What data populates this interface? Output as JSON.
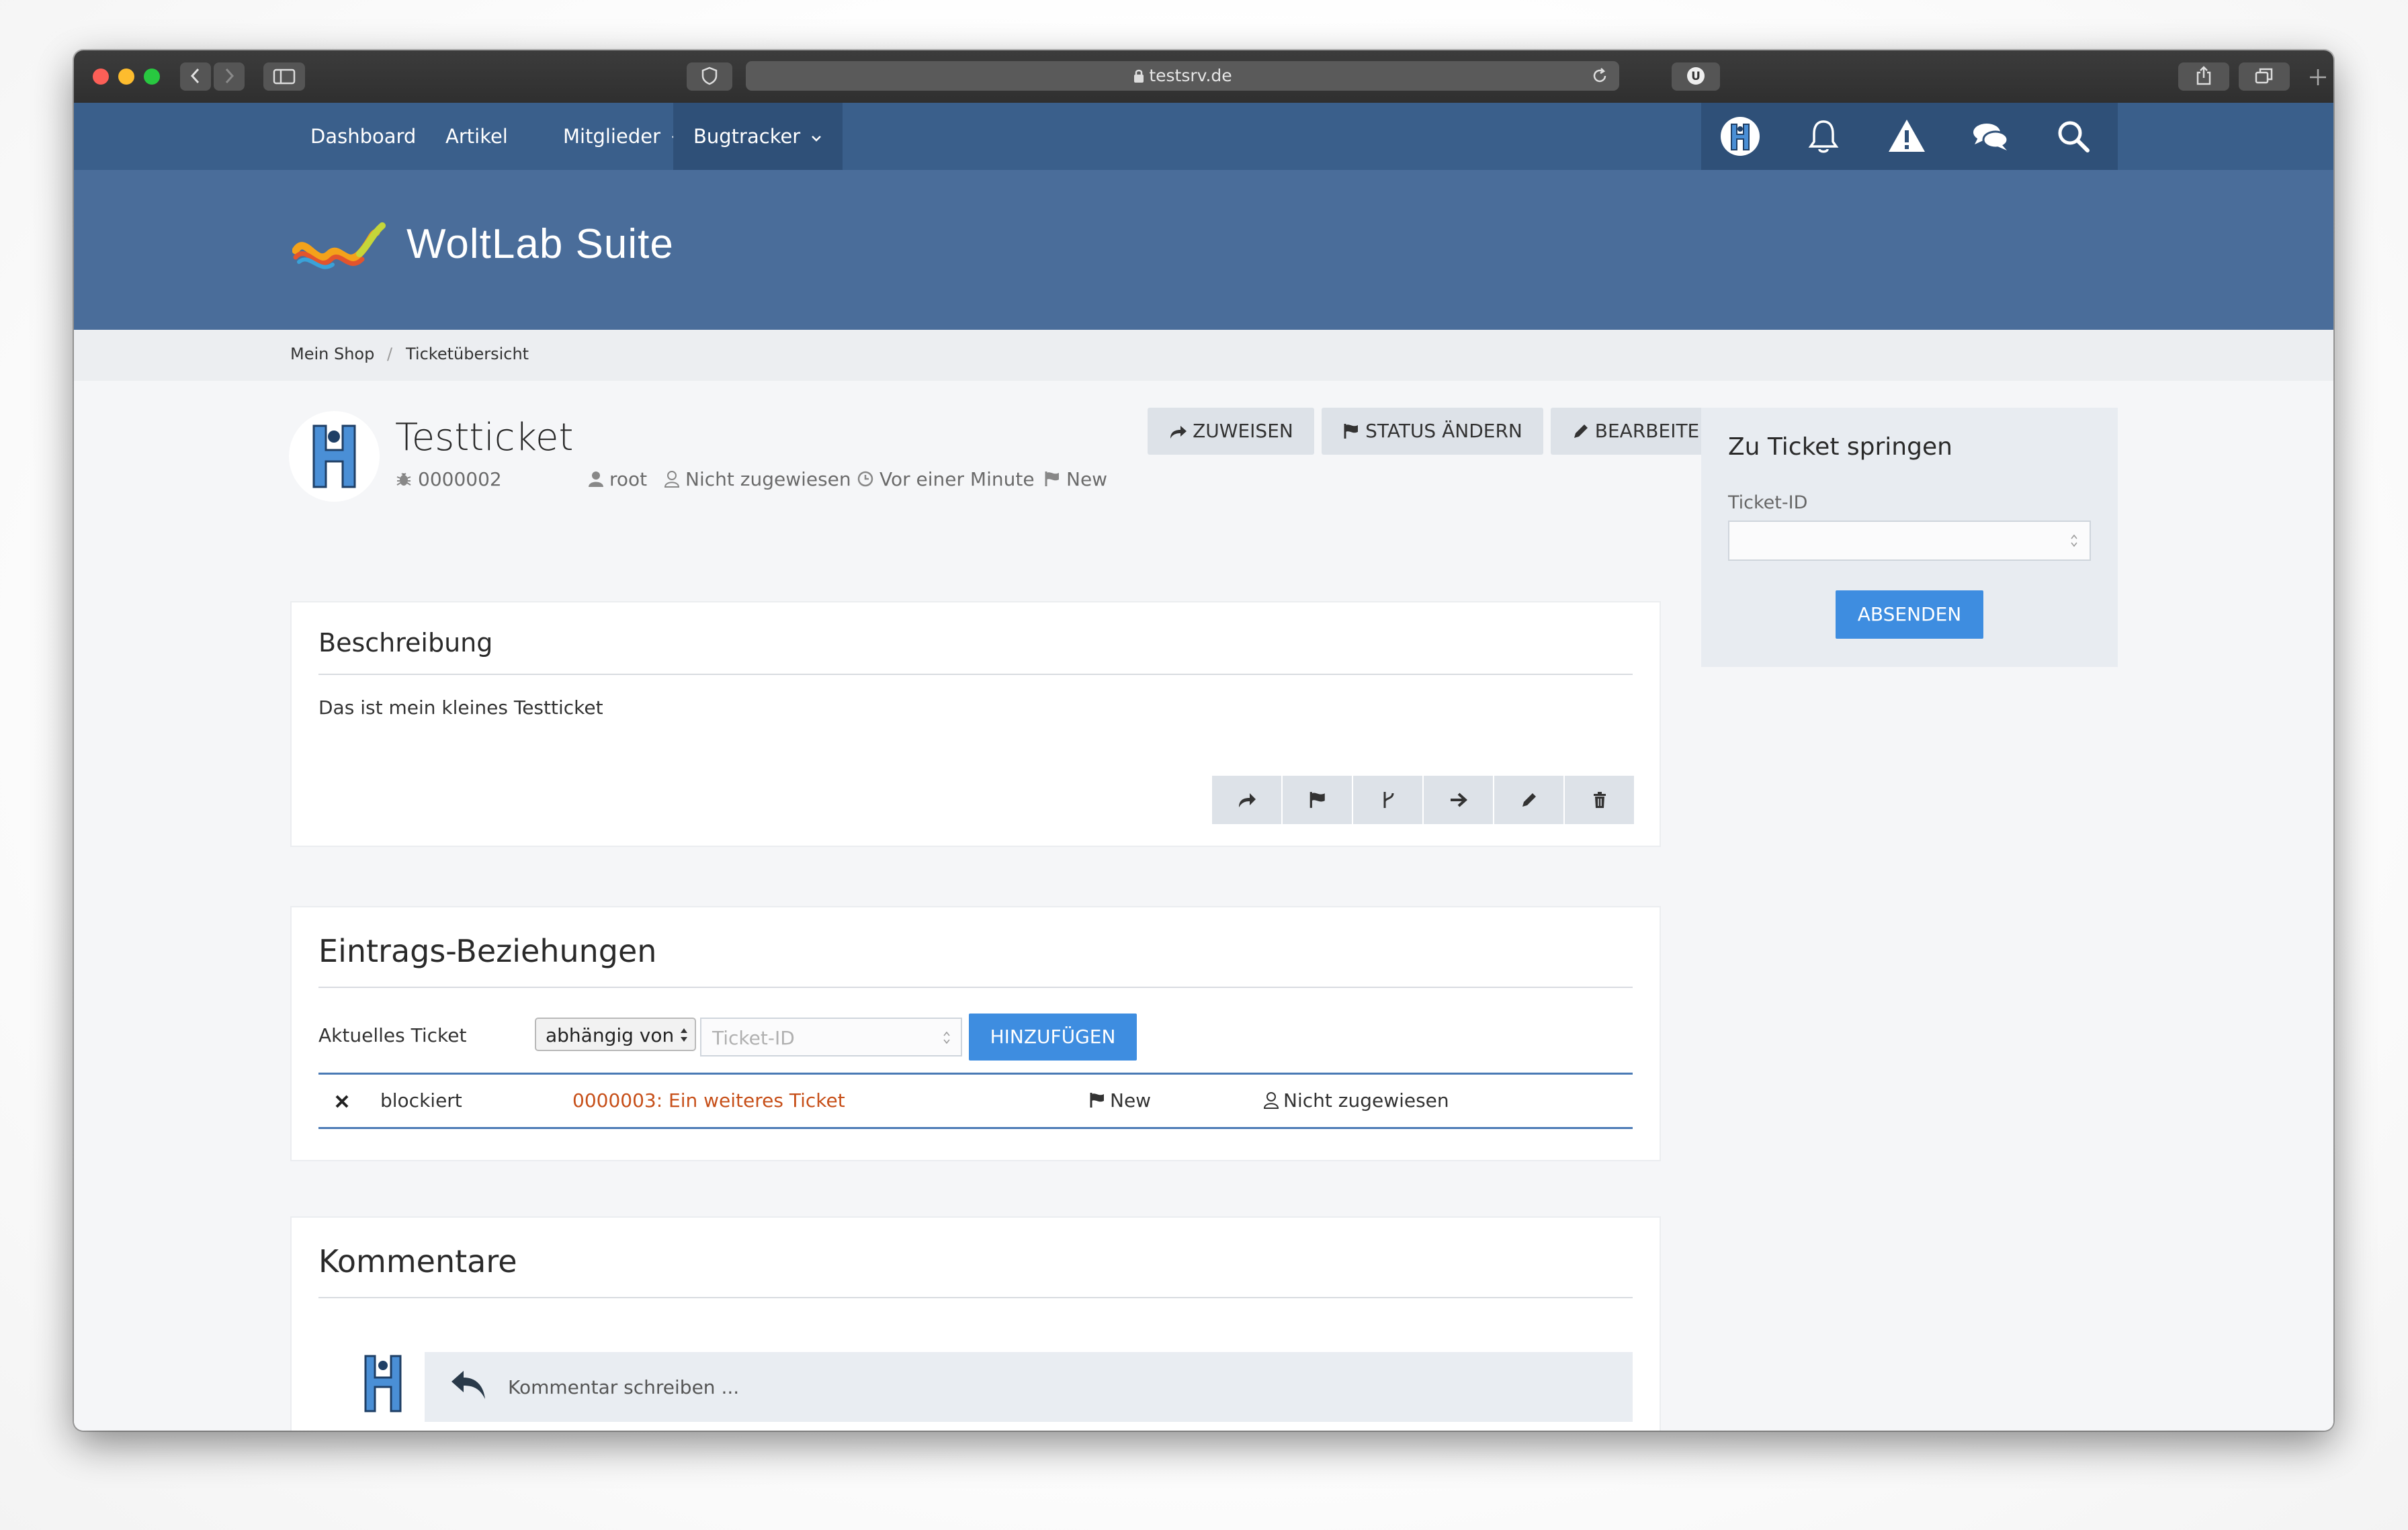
{
  "browser": {
    "url": "testsrv.de"
  },
  "nav": {
    "items": [
      {
        "label": "Dashboard"
      },
      {
        "label": "Artikel"
      },
      {
        "label": "Mitglieder"
      },
      {
        "label": "Bugtracker"
      }
    ],
    "icons": [
      "user-avatar-icon",
      "bell-icon",
      "warning-icon",
      "chat-icon",
      "search-icon"
    ]
  },
  "brand": {
    "name": "WoltLab Suite"
  },
  "breadcrumb": {
    "items": [
      {
        "label": "Mein Shop"
      },
      {
        "label": "/"
      },
      {
        "label": "Ticketübersicht"
      }
    ]
  },
  "ticket": {
    "title": "Testticket",
    "id": "0000002",
    "author": "root",
    "assignee": "Nicht zugewiesen",
    "time": "Vor einer Minute",
    "status": "New"
  },
  "actions": {
    "assign": "ZUWEISEN",
    "change_status": "STATUS ÄNDERN",
    "edit": "BEARBEITEN"
  },
  "description": {
    "heading": "Beschreibung",
    "text": "Das ist mein kleines Testticket"
  },
  "relations": {
    "heading": "Eintrags-Beziehungen",
    "label": "Aktuelles Ticket",
    "relation_value": "abhängig von",
    "ticket_placeholder": "Ticket-ID",
    "add_button": "HINZUFÜGEN",
    "rows": [
      {
        "type": "blockiert",
        "ticket": "0000003: Ein weiteres Ticket",
        "status": "New",
        "assignee": "Nicht zugewiesen"
      }
    ]
  },
  "comments": {
    "heading": "Kommentare",
    "placeholder": "Kommentar schreiben ..."
  },
  "sidebar": {
    "heading": "Zu Ticket springen",
    "field_label": "Ticket-ID",
    "submit": "ABSENDEN"
  },
  "colors": {
    "nav_bg": "#3a5f8b",
    "header_bg": "#4a6d9a",
    "accent_blue": "#3e8de0",
    "link_orange": "#c7501a"
  }
}
